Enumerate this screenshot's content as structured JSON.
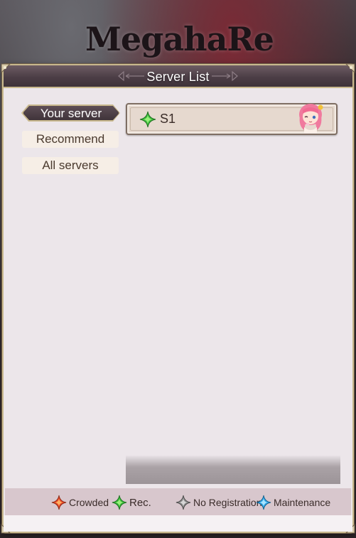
{
  "backdrop": {
    "logo_main": "MegahaRe",
    "logo_accent": ""
  },
  "window": {
    "title": "Server List"
  },
  "tabs": [
    {
      "label": "Your server",
      "active": true
    },
    {
      "label": "Recommend",
      "active": false
    },
    {
      "label": "All servers",
      "active": false
    }
  ],
  "servers": [
    {
      "name": "S1",
      "status": "Rec.",
      "status_icon": "green-diamond-icon",
      "avatar": "pink-hair-character-icon"
    }
  ],
  "legend": [
    {
      "label": "Crowded",
      "icon": "red-diamond-icon",
      "color": "#e8452a"
    },
    {
      "label": "Rec.",
      "icon": "green-diamond-icon",
      "color": "#36b83a"
    },
    {
      "label": "No Registration",
      "icon": "gray-diamond-icon",
      "color": "#8a8a8a"
    },
    {
      "label": "Maintenance",
      "icon": "blue-diamond-icon",
      "color": "#2ea6e8"
    }
  ],
  "colors": {
    "frame_gold": "#c9b98e",
    "title_bar": "#4c3e46",
    "panel_bg": "#ece6ea",
    "legend_bg": "#d8c7cd"
  }
}
